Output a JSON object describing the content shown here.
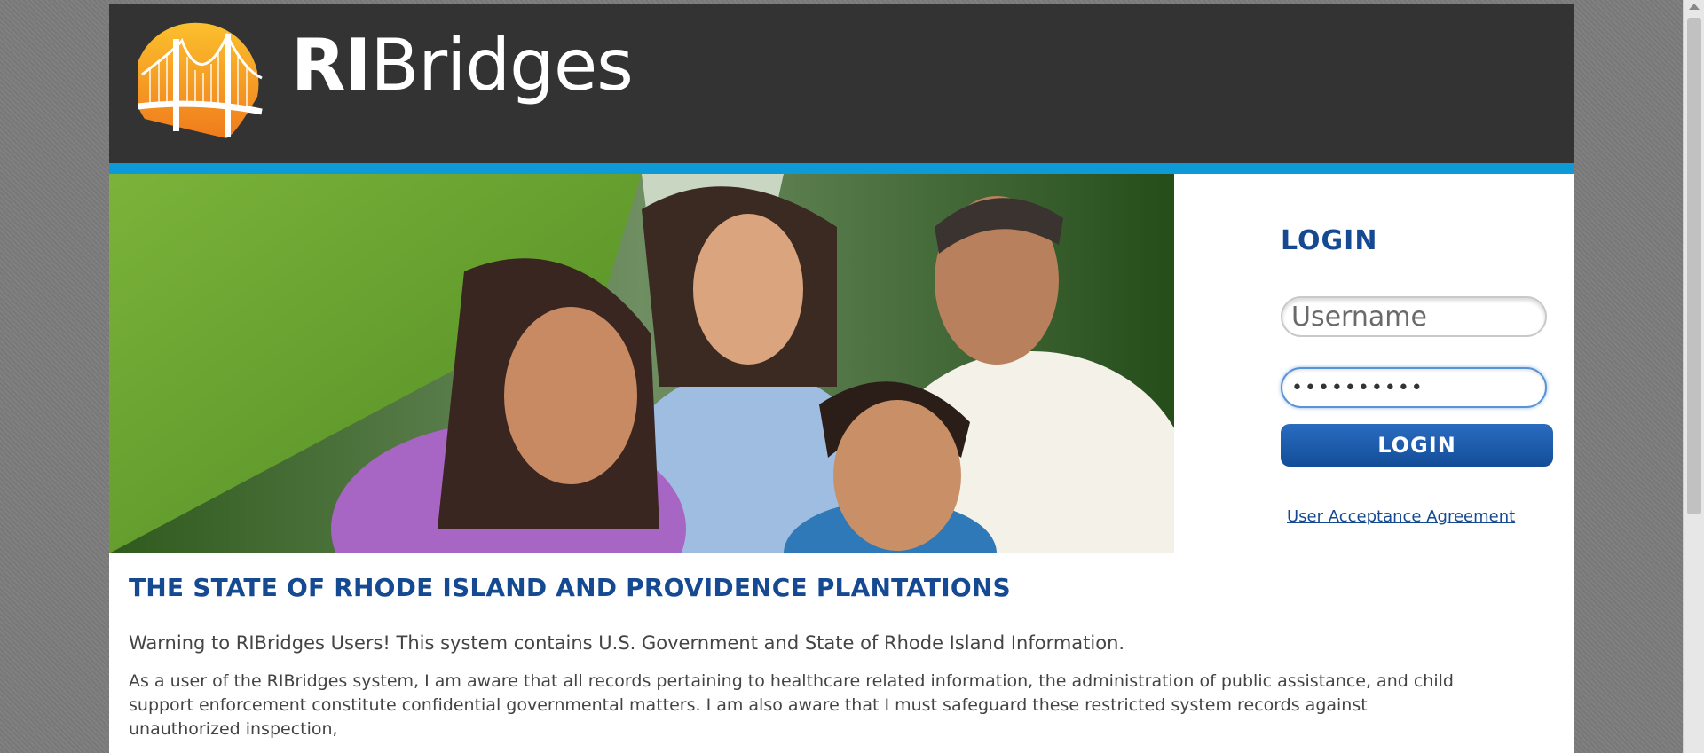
{
  "brand": {
    "logo_name_bold": "RI",
    "logo_name_regular": "Bridges"
  },
  "login": {
    "title": "LOGIN",
    "username_placeholder": "Username",
    "password_value": "••••••••••",
    "button_label": "LOGIN",
    "agreement_link": "User Acceptance Agreement"
  },
  "notice": {
    "title": "THE STATE OF RHODE ISLAND AND PROVIDENCE PLANTATIONS",
    "warning": "Warning to RIBridges Users! This system contains U.S. Government and State of Rhode Island Information.",
    "paragraph": "As a user of the RIBridges system, I am aware that all records pertaining to healthcare related information, the administration of public assistance, and child support enforcement constitute confidential governmental matters. I am also aware that I must safeguard these restricted system records against unauthorized inspection,"
  },
  "colors": {
    "header_bg": "#333333",
    "accent_stripe": "#0e9ad7",
    "heading_blue": "#154a93",
    "button_blue": "#1d5fae"
  },
  "icons": {
    "logo": "bridge-sun-logo-icon"
  }
}
